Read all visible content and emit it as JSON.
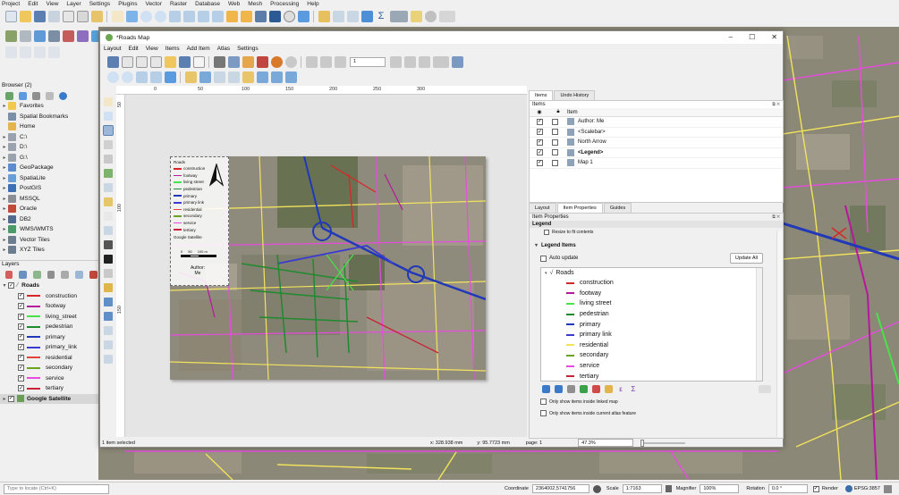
{
  "main_menu": [
    "Project",
    "Edit",
    "View",
    "Layer",
    "Settings",
    "Plugins",
    "Vector",
    "Raster",
    "Database",
    "Web",
    "Mesh",
    "Processing",
    "Help"
  ],
  "browser": {
    "title": "Browser (2)",
    "items": [
      {
        "label": "Favorites",
        "icon": "star-icon",
        "color": "#f2c94c"
      },
      {
        "label": "Spatial Bookmarks",
        "icon": "bookmark-icon",
        "color": "#7b8fa8"
      },
      {
        "label": "Home",
        "icon": "folder-icon",
        "color": "#e6b44c"
      },
      {
        "label": "C:\\",
        "icon": "drive-icon",
        "color": "#9aa3ad"
      },
      {
        "label": "D:\\",
        "icon": "drive-icon",
        "color": "#9aa3ad"
      },
      {
        "label": "G:\\",
        "icon": "drive-icon",
        "color": "#9aa3ad"
      },
      {
        "label": "GeoPackage",
        "icon": "geopackage-icon",
        "color": "#5b8bd0"
      },
      {
        "label": "SpatiaLite",
        "icon": "spatialite-icon",
        "color": "#6a9ed9"
      },
      {
        "label": "PostGIS",
        "icon": "postgis-icon",
        "color": "#3b6fb6"
      },
      {
        "label": "MSSQL",
        "icon": "mssql-icon",
        "color": "#8a8f96"
      },
      {
        "label": "Oracle",
        "icon": "oracle-icon",
        "color": "#c24a3a"
      },
      {
        "label": "DB2",
        "icon": "db2-icon",
        "color": "#4f6c8f"
      },
      {
        "label": "WMS/WMTS",
        "icon": "globe-icon",
        "color": "#4b9a6a"
      },
      {
        "label": "Vector Tiles",
        "icon": "grid-icon",
        "color": "#6c7d90"
      },
      {
        "label": "XYZ Tiles",
        "icon": "grid-icon",
        "color": "#6c7d90"
      }
    ]
  },
  "layers": {
    "title": "Layers",
    "group": "Roads",
    "items": [
      {
        "label": "construction",
        "color": "#d62728"
      },
      {
        "label": "footway",
        "color": "#b5179e"
      },
      {
        "label": "living_street",
        "color": "#49e24a"
      },
      {
        "label": "pedestrian",
        "color": "#1f8a2e"
      },
      {
        "label": "primary",
        "color": "#2138b8"
      },
      {
        "label": "primary_link",
        "color": "#3b3bd1"
      },
      {
        "label": "residential",
        "color": "#e0443c"
      },
      {
        "label": "secondary",
        "color": "#6aa31f"
      },
      {
        "label": "service",
        "color": "#e84be0"
      },
      {
        "label": "tertiary",
        "color": "#c7243a"
      }
    ],
    "basemap": "Google Satellite"
  },
  "locator_placeholder": "Type to locate (Ctrl+K)",
  "status": {
    "coordinate_label": "Coordinate",
    "coordinate": "2364002,5741756",
    "scale_label": "Scale",
    "scale": "1:7163",
    "magnifier_label": "Magnifier",
    "magnifier": "100%",
    "rotation_label": "Rotation",
    "rotation": "0.0 °",
    "render_label": "Render",
    "crs": "EPSG:3857"
  },
  "layout": {
    "title": "*Roads Map",
    "menu": [
      "Layout",
      "Edit",
      "View",
      "Items",
      "Add Item",
      "Atlas",
      "Settings"
    ],
    "page_field": "1",
    "ruler_ticks": [
      "0",
      "50",
      "100",
      "150",
      "200",
      "250",
      "300"
    ],
    "ruler_v_ticks": [
      "50",
      "100",
      "150"
    ],
    "map_legend": {
      "title": "Roads",
      "entries": [
        "construction",
        "footway",
        "living street",
        "pedestrian",
        "primary",
        "primary link",
        "residential",
        "secondary",
        "service",
        "tertiary"
      ],
      "source": "Google Satellite",
      "scale_ticks": [
        "0",
        "50",
        "100 m"
      ],
      "author": "Author: Me"
    },
    "items_panel": {
      "tabs": [
        "Items",
        "Undo History"
      ],
      "section": "Items",
      "header": "Item",
      "rows": [
        "Author: Me",
        "<Scalebar>",
        "North Arrow",
        "<Legend>",
        "Map 1"
      ]
    },
    "props_panel": {
      "tabs": [
        "Layout",
        "Item Properties",
        "Guides"
      ],
      "section": "Item Properties",
      "subsection": "Legend",
      "resize_label": "Resize to fit contents",
      "legend_items_label": "Legend Items",
      "auto_update": "Auto update",
      "update_all": "Update All",
      "group": "Roads",
      "entries": [
        {
          "label": "construction",
          "color": "#d62728"
        },
        {
          "label": "footway",
          "color": "#b5179e"
        },
        {
          "label": "living street",
          "color": "#49e24a"
        },
        {
          "label": "pedestrian",
          "color": "#1f8a2e"
        },
        {
          "label": "primary",
          "color": "#2138b8"
        },
        {
          "label": "primary link",
          "color": "#3b3bd1"
        },
        {
          "label": "residential",
          "color": "#f2e35c"
        },
        {
          "label": "secondary",
          "color": "#6aa31f"
        },
        {
          "label": "service",
          "color": "#e84be0"
        },
        {
          "label": "tertiary",
          "color": "#c7243a"
        }
      ],
      "only_linked_map": "Only show items inside linked map",
      "only_atlas": "Only show items inside current atlas feature"
    },
    "status": {
      "selected": "1 item selected",
      "x": "x: 328.938 mm",
      "y": "y: 95.7723 mm",
      "page": "page: 1",
      "zoom": "47.3%"
    }
  }
}
